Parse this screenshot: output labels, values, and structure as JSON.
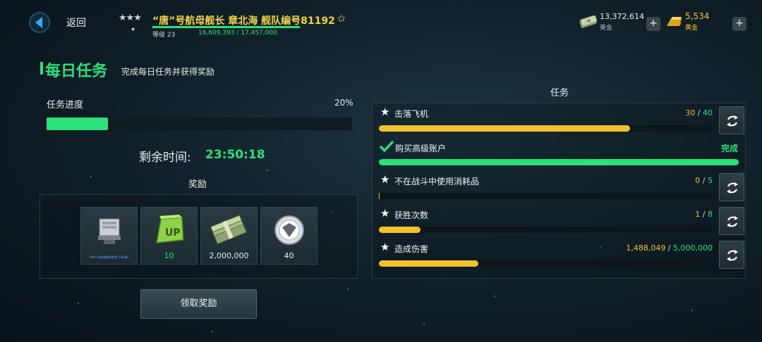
{
  "topbar": {
    "back_label": "返回",
    "rank_stars": "★★★",
    "rank_sub_star": "★",
    "player_title": "“唐”号航母舰长  章北海  舰队编号81192",
    "fav_star": "✩",
    "level": "等级 23",
    "xp": "16,609,393 / 17,457,000",
    "xp_progress": 0.951,
    "money_value": "13,372,614",
    "money_name": "美金",
    "gold_value": "5,534",
    "gold_name": "黄金",
    "plus": "+"
  },
  "header": {
    "title": "每日任务",
    "subtitle": "完成每日任务并获得奖励"
  },
  "progress": {
    "label": "任务进度",
    "percent_text": "20%",
    "value": 0.2
  },
  "timer": {
    "label": "剩余时间:",
    "value": "23:50:18"
  },
  "rewards": {
    "title": "奖励",
    "items": [
      {
        "icon": "equipment-crate-icon",
        "qty": "",
        "tiny_text": "AM-9 武器增强装置包 (200级)"
      },
      {
        "icon": "upgrade-token-icon",
        "qty": "10"
      },
      {
        "icon": "cash-stack-icon",
        "qty": "2,000,000"
      },
      {
        "icon": "fleet-emblem-icon",
        "qty": "40"
      }
    ],
    "claim_label": "领取奖励"
  },
  "tasks": {
    "title": "任务",
    "items": [
      {
        "name": "击落飞机",
        "current": "30",
        "sep": " / ",
        "total": "40",
        "progress": 0.75,
        "done": false
      },
      {
        "name": "购买高级账户",
        "status": "完成",
        "progress": 1.0,
        "done": true
      },
      {
        "name": "不在战斗中使用消耗品",
        "current": "0",
        "sep": " / ",
        "total": "5",
        "progress": 0.0,
        "done": false
      },
      {
        "name": "获胜次数",
        "current": "1",
        "sep": " / ",
        "total": "8",
        "progress": 0.125,
        "done": false
      },
      {
        "name": "造成伤害",
        "current": "1,488,049",
        "sep": " / ",
        "total": "5,000,000",
        "progress": 0.298,
        "done": false
      }
    ]
  },
  "colors": {
    "accent_green": "#2ee07a",
    "accent_yellow": "#f2c12e"
  }
}
